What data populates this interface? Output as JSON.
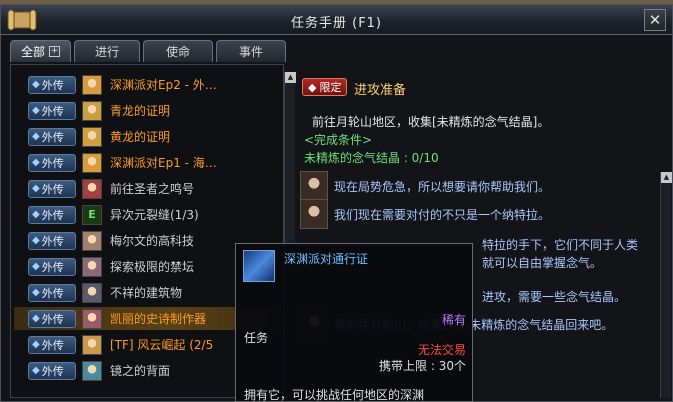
{
  "window": {
    "title": "任务手册 (F1)",
    "close_symbol": "✕"
  },
  "tabs": [
    {
      "label": "全部",
      "plus": "+"
    },
    {
      "label": "进行"
    },
    {
      "label": "使命"
    },
    {
      "label": "事件"
    }
  ],
  "quests": [
    {
      "tag": "外传",
      "title": "深渊派对Ep2 - 外…",
      "color": "#ff9a2a",
      "selected": false
    },
    {
      "tag": "外传",
      "title": "青龙的证明",
      "color": "#ff9a2a",
      "selected": false
    },
    {
      "tag": "外传",
      "title": "黄龙的证明",
      "color": "#ff9a2a",
      "selected": false
    },
    {
      "tag": "外传",
      "title": "深渊派对Ep1 - 海…",
      "color": "#ff9a2a",
      "selected": false
    },
    {
      "tag": "外传",
      "title": "前往圣者之鸣号",
      "color": "#d0d0d0",
      "selected": false
    },
    {
      "tag": "外传",
      "title": "异次元裂缝(1/3)",
      "color": "#d0d0d0",
      "icon_text": "E",
      "selected": false
    },
    {
      "tag": "外传",
      "title": "梅尔文的高科技",
      "color": "#d0d0d0",
      "selected": false
    },
    {
      "tag": "外传",
      "title": "探索极限的禁坛",
      "color": "#d0d0d0",
      "selected": false
    },
    {
      "tag": "外传",
      "title": "不祥的建筑物",
      "color": "#d0d0d0",
      "selected": false
    },
    {
      "tag": "外传",
      "title": "凯丽的史诗制作器",
      "color": "#ff9a2a",
      "selected": true
    },
    {
      "tag": "外传",
      "title": "[TF] 风云崛起 (2/5",
      "color": "#ff9a2a",
      "selected": false
    },
    {
      "tag": "外传",
      "title": "镜之的背面",
      "color": "#d0d0d0",
      "selected": false
    }
  ],
  "detail": {
    "badge": "限定",
    "title": "进攻准备",
    "description": "前往月轮山地区，收集[未精炼的念气结晶]。",
    "condition_label": "<完成条件>",
    "condition_item": "未精炼的念气结晶 : 0/10",
    "dialog": [
      "现在局势危急，所以想要请你帮助我们。",
      "我们现在需要对付的不只是一个纳特拉。",
      "特拉的手下，它们不同于人类",
      "就可以自由掌握念气。",
      "进攻，需要一些念气结晶。",
      "请前往月轮山，收集10个未精炼的念气结晶回来吧。"
    ]
  },
  "tooltip": {
    "name": "深渊派对通行证",
    "type": "任务",
    "rarity": "稀有",
    "trade": "无法交易",
    "carry_limit": "携带上限 : 30个",
    "description": "拥有它，可以挑战任何地区的深渊"
  },
  "scroll": {
    "up": "▲"
  }
}
